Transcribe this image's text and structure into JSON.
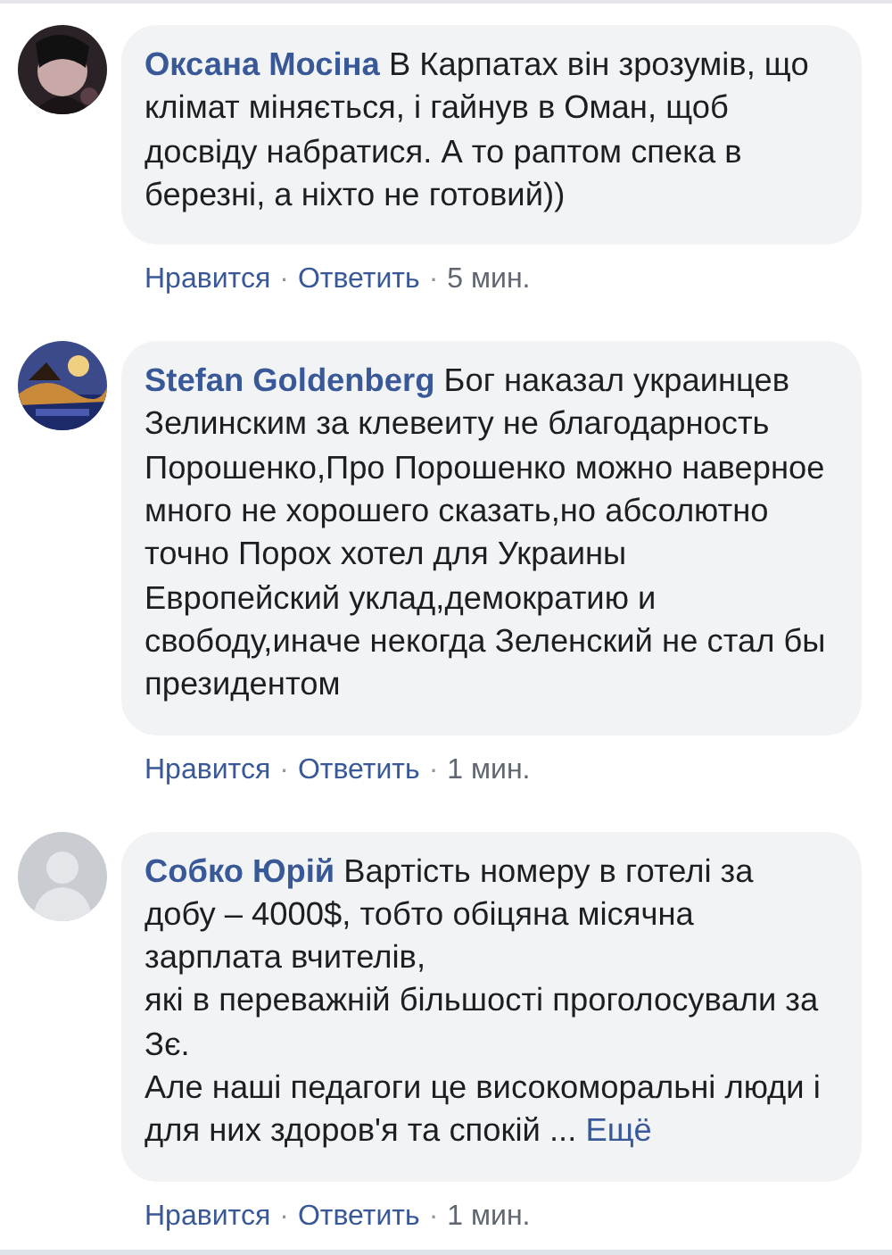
{
  "comments": [
    {
      "author": "Оксана Мосіна",
      "text": "В Карпатах він зрозумів, що клімат міняється, і гайнув в Оман, щоб досвіду набратися. А то раптом спека в березні, а ніхто не готовий))",
      "footer": [
        {
          "kind": "link",
          "text": "Нравится"
        },
        {
          "kind": "dot",
          "text": "·"
        },
        {
          "kind": "link",
          "text": "Ответить"
        },
        {
          "kind": "dot",
          "text": "·"
        },
        {
          "kind": "time",
          "text": "5 мин."
        }
      ]
    },
    {
      "author": "Stefan Goldenberg",
      "text": "Бог наказал украинцев Зелинским за клевеиту не благодарность Порошенко,Про Порошенко можно наверное много не хорошего сказать,но абсолютно точно Порох хотел для Украины Европейский уклад,демократию и свободу,иначе некогда Зеленский не стал бы президентом",
      "footer": [
        {
          "kind": "link",
          "text": "Нравится"
        },
        {
          "kind": "dot",
          "text": "·"
        },
        {
          "kind": "link",
          "text": "Ответить"
        },
        {
          "kind": "dot",
          "text": "·"
        },
        {
          "kind": "time",
          "text": "1 мин."
        }
      ]
    },
    {
      "avatar": {
        "kind": "default"
      },
      "author": "Собко Юрій",
      "text": "Вартість номеру в готелі за добу – 4000$, тобто обіцяна місячна зарплата вчителів,\nякі в переважній більшості проголосували за Зє.\nАле наші педагоги це високоморальні люди і для них здоров'я та спокій ...",
      "more_link": "Ещё",
      "footer": [
        {
          "kind": "link",
          "text": "Нравится"
        },
        {
          "kind": "dot",
          "text": "·"
        },
        {
          "kind": "link",
          "text": "Ответить"
        },
        {
          "kind": "dot",
          "text": "·"
        },
        {
          "kind": "time",
          "text": "1 мин."
        }
      ]
    }
  ]
}
